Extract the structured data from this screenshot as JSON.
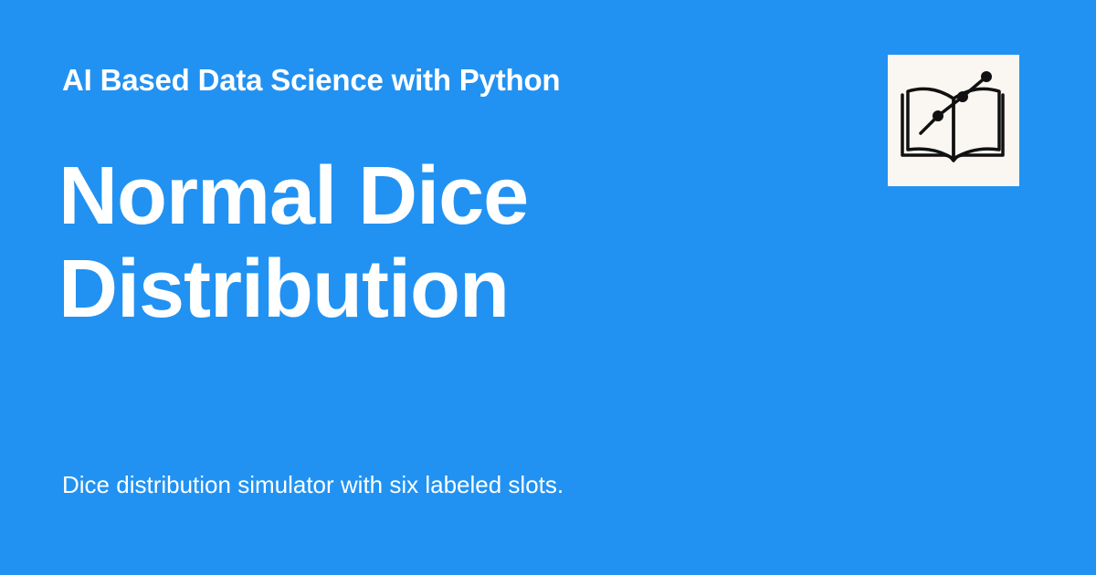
{
  "header": {
    "site_title": "AI Based Data Science with Python"
  },
  "main": {
    "title_lines": [
      "Normal Dice",
      "Distribution"
    ],
    "description": "Dice distribution simulator with six labeled slots."
  },
  "logo": {
    "icon": "book-chart-icon"
  },
  "colors": {
    "background": "#2192F2",
    "text": "#FFFFFF",
    "logo_background": "#FAF7F2",
    "logo_ink": "#111111"
  }
}
